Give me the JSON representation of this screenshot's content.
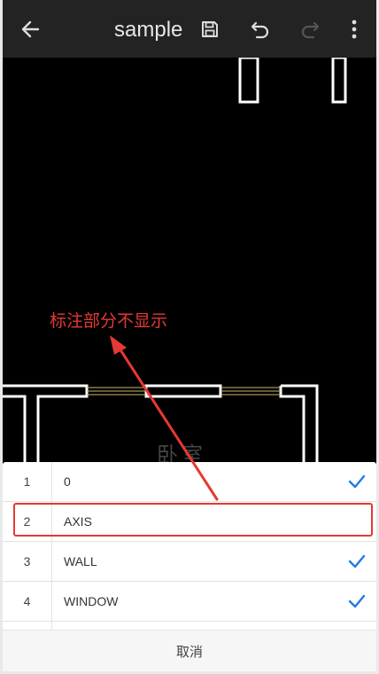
{
  "toolbar": {
    "title": "sample",
    "icons": [
      "back-arrow-icon",
      "save-icon",
      "undo-icon",
      "redo-icon",
      "more-vert-icon"
    ]
  },
  "canvas": {
    "room_label": "卧室"
  },
  "annotation": {
    "text": "标注部分不显示",
    "color": "#e53935"
  },
  "layers": [
    {
      "num": "1",
      "name": "0",
      "checked": true
    },
    {
      "num": "2",
      "name": "AXIS",
      "checked": false
    },
    {
      "num": "3",
      "name": "WALL",
      "checked": true
    },
    {
      "num": "4",
      "name": "WINDOW",
      "checked": true
    }
  ],
  "cancel_label": "取消",
  "colors": {
    "accent": "#1e7be5",
    "annotation_red": "#e53935",
    "toolbar_bg": "#232323"
  }
}
